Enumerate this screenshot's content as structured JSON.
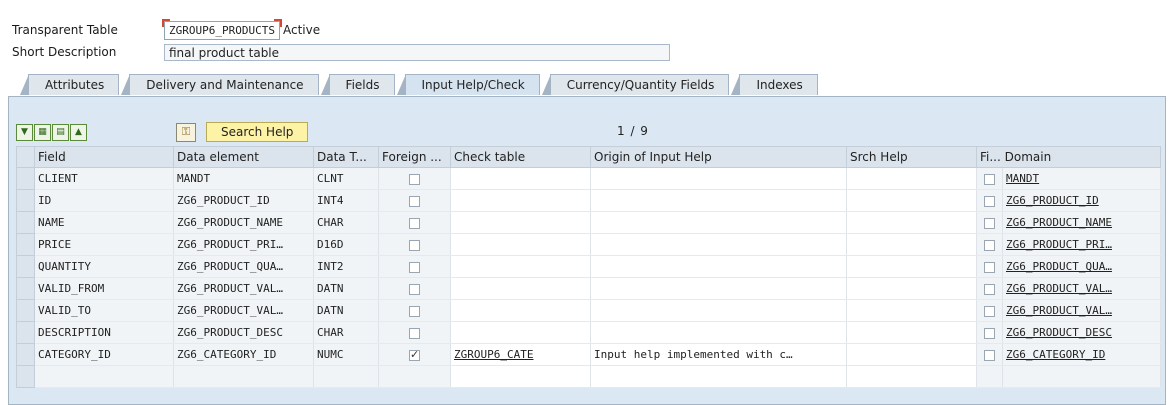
{
  "header": {
    "table_type_label": "Transparent Table",
    "table_name": "ZGROUP6_PRODUCTS",
    "status": "Active",
    "short_desc_label": "Short Description",
    "short_desc_value": "final product table"
  },
  "tabs": [
    {
      "label": "Attributes"
    },
    {
      "label": "Delivery and Maintenance"
    },
    {
      "label": "Fields"
    },
    {
      "label": "Input Help/Check"
    },
    {
      "label": "Currency/Quantity Fields"
    },
    {
      "label": "Indexes"
    }
  ],
  "active_tab": "Input Help/Check",
  "toolbar": {
    "search_help_label": "Search Help",
    "pager": "1 / 9"
  },
  "table": {
    "columns": [
      "Field",
      "Data element",
      "Data T...",
      "Foreign ...",
      "Check table",
      "Origin of Input Help",
      "Srch Help",
      "Fi...",
      "Domain"
    ],
    "rows": [
      {
        "field": "CLIENT",
        "data_element": "MANDT",
        "data_type": "CLNT",
        "foreign": false,
        "check_table": "",
        "origin": "",
        "srch_help": "",
        "fixed": false,
        "domain": "MANDT"
      },
      {
        "field": "ID",
        "data_element": "ZG6_PRODUCT_ID",
        "data_type": "INT4",
        "foreign": false,
        "check_table": "",
        "origin": "",
        "srch_help": "",
        "fixed": false,
        "domain": "ZG6_PRODUCT_ID"
      },
      {
        "field": "NAME",
        "data_element": "ZG6_PRODUCT_NAME",
        "data_type": "CHAR",
        "foreign": false,
        "check_table": "",
        "origin": "",
        "srch_help": "",
        "fixed": false,
        "domain": "ZG6_PRODUCT_NAME"
      },
      {
        "field": "PRICE",
        "data_element": "ZG6_PRODUCT_PRI…",
        "data_type": "D16D",
        "foreign": false,
        "check_table": "",
        "origin": "",
        "srch_help": "",
        "fixed": false,
        "domain": "ZG6_PRODUCT_PRI…"
      },
      {
        "field": "QUANTITY",
        "data_element": "ZG6_PRODUCT_QUA…",
        "data_type": "INT2",
        "foreign": false,
        "check_table": "",
        "origin": "",
        "srch_help": "",
        "fixed": false,
        "domain": "ZG6_PRODUCT_QUA…"
      },
      {
        "field": "VALID_FROM",
        "data_element": "ZG6_PRODUCT_VAL…",
        "data_type": "DATN",
        "foreign": false,
        "check_table": "",
        "origin": "",
        "srch_help": "",
        "fixed": false,
        "domain": "ZG6_PRODUCT_VAL…"
      },
      {
        "field": "VALID_TO",
        "data_element": "ZG6_PRODUCT_VAL…",
        "data_type": "DATN",
        "foreign": false,
        "check_table": "",
        "origin": "",
        "srch_help": "",
        "fixed": false,
        "domain": "ZG6_PRODUCT_VAL…"
      },
      {
        "field": "DESCRIPTION",
        "data_element": "ZG6_PRODUCT_DESC",
        "data_type": "CHAR",
        "foreign": false,
        "check_table": "",
        "origin": "",
        "srch_help": "",
        "fixed": false,
        "domain": "ZG6_PRODUCT_DESC"
      },
      {
        "field": "CATEGORY_ID",
        "data_element": "ZG6_CATEGORY_ID",
        "data_type": "NUMC",
        "foreign": true,
        "check_table": "ZGROUP6_CATE",
        "origin": "Input help implemented with c…",
        "srch_help": "",
        "fixed": false,
        "domain": "ZG6_CATEGORY_ID"
      }
    ]
  },
  "icons": {
    "tb1": "expand-all-icon",
    "tb2": "select-all-icon",
    "tb3": "deselect-all-icon",
    "tb4": "collapse-icon",
    "key": "key-icon"
  },
  "colors": {
    "panel_bg": "#dbe8f3",
    "search_btn_bg": "#fdf3a6",
    "error_marker": "#d04a3a"
  }
}
